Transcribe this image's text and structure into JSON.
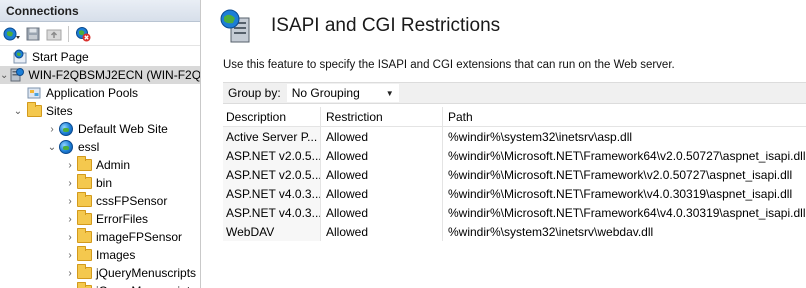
{
  "connections": {
    "title": "Connections",
    "toolbar": [
      {
        "icon": "connect-globe-icon"
      },
      {
        "icon": "save-icon"
      },
      {
        "icon": "folder-up-icon"
      },
      {
        "icon": "disconnect-icon"
      }
    ],
    "tree": [
      {
        "label": "Start Page",
        "icon": "start-page-icon",
        "level": 0,
        "expander": "none"
      },
      {
        "label": "WIN-F2QBSMJ2ECN (WIN-F2Q",
        "icon": "server-icon",
        "level": 0,
        "expander": "expanded",
        "selected": true
      },
      {
        "label": "Application Pools",
        "icon": "app-pools-icon",
        "level": 1,
        "expander": "none"
      },
      {
        "label": "Sites",
        "icon": "folder-icon",
        "level": 1,
        "expander": "expanded"
      },
      {
        "label": "Default Web Site",
        "icon": "globe-icon",
        "level": 2,
        "expander": "collapsed"
      },
      {
        "label": "essl",
        "icon": "globe-icon",
        "level": 2,
        "expander": "expanded"
      },
      {
        "label": "Admin",
        "icon": "folder-icon",
        "level": 3,
        "expander": "collapsed"
      },
      {
        "label": "bin",
        "icon": "folder-icon",
        "level": 3,
        "expander": "collapsed"
      },
      {
        "label": "cssFPSensor",
        "icon": "folder-icon",
        "level": 3,
        "expander": "collapsed"
      },
      {
        "label": "ErrorFiles",
        "icon": "folder-icon",
        "level": 3,
        "expander": "collapsed"
      },
      {
        "label": "imageFPSensor",
        "icon": "folder-icon",
        "level": 3,
        "expander": "collapsed"
      },
      {
        "label": "Images",
        "icon": "folder-icon",
        "level": 3,
        "expander": "collapsed"
      },
      {
        "label": "jQueryMenuscripts",
        "icon": "folder-icon",
        "level": 3,
        "expander": "collapsed"
      },
      {
        "label": "jQueryMenuscripts",
        "icon": "folder-icon",
        "level": 3,
        "expander": "collapsed"
      }
    ]
  },
  "feature": {
    "title": "ISAPI and CGI Restrictions",
    "icon": "isapi-cgi-icon",
    "description": "Use this feature to specify the ISAPI and CGI extensions that can run on the Web server."
  },
  "group_by": {
    "label": "Group by:",
    "value": "No Grouping"
  },
  "table": {
    "columns": [
      "Description",
      "Restriction",
      "Path"
    ],
    "rows": [
      [
        "Active Server P...",
        "Allowed",
        "%windir%\\system32\\inetsrv\\asp.dll"
      ],
      [
        "ASP.NET v2.0.5...",
        "Allowed",
        "%windir%\\Microsoft.NET\\Framework64\\v2.0.50727\\aspnet_isapi.dll"
      ],
      [
        "ASP.NET v2.0.5...",
        "Allowed",
        "%windir%\\Microsoft.NET\\Framework\\v2.0.50727\\aspnet_isapi.dll"
      ],
      [
        "ASP.NET v4.0.3...",
        "Allowed",
        "%windir%\\Microsoft.NET\\Framework\\v4.0.30319\\aspnet_isapi.dll"
      ],
      [
        "ASP.NET v4.0.3...",
        "Allowed",
        "%windir%\\Microsoft.NET\\Framework64\\v4.0.30319\\aspnet_isapi.dll"
      ],
      [
        "WebDAV",
        "Allowed",
        "%windir%\\system32\\inetsrv\\webdav.dll"
      ]
    ]
  }
}
